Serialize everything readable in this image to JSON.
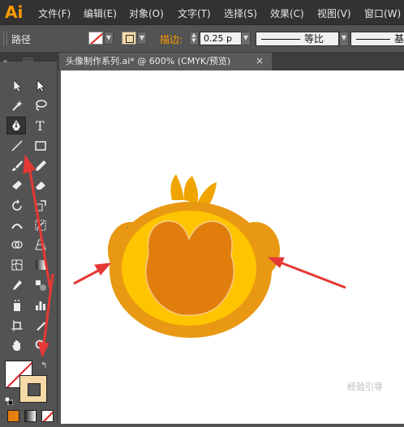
{
  "app": {
    "logo": "Ai"
  },
  "menu": {
    "items": [
      "文件(F)",
      "编辑(E)",
      "对象(O)",
      "文字(T)",
      "选择(S)",
      "效果(C)",
      "视图(V)",
      "窗口(W)"
    ]
  },
  "control_bar": {
    "selection_label": "路径",
    "stroke_label": "描边:",
    "stroke_weight": "0.25 p",
    "profile_label": "等比",
    "brush_label": "基"
  },
  "document": {
    "tab_title": "头像制作系列.ai* @ 600% (CMYK/预览)",
    "close_glyph": "×"
  },
  "watermark": "经验引导",
  "colors": {
    "accent": "#ff9a00",
    "fill_swatch": "#e87e0c",
    "stroke_swatch": "#f5d9a6",
    "monkey_outer": "#e89812",
    "monkey_face": "#ffc400",
    "monkey_inner": "#e07d0c"
  }
}
